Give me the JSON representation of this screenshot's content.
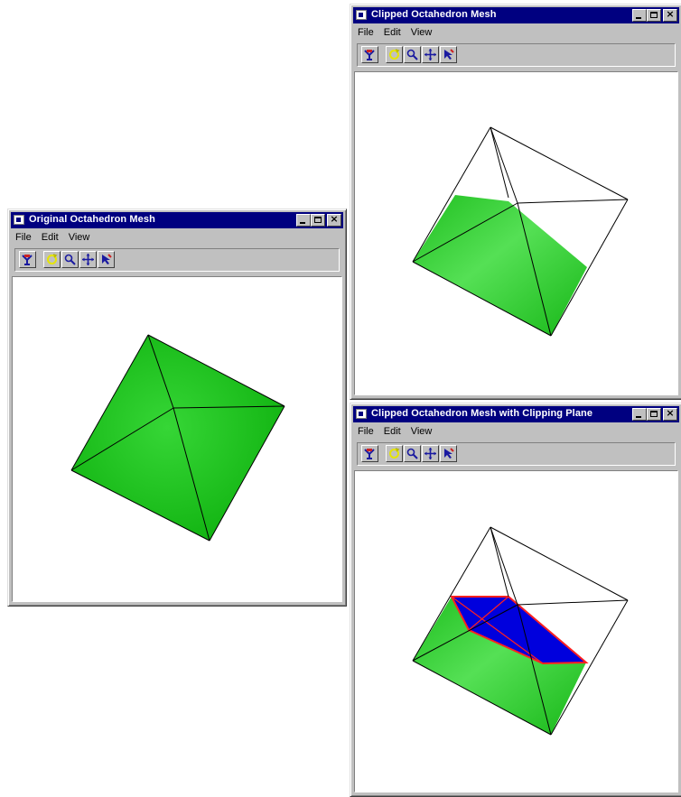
{
  "menu": [
    "File",
    "Edit",
    "View"
  ],
  "title_buttons": {
    "minimize": "minimize-icon",
    "maximize": "maximize-icon",
    "close": "close-icon"
  },
  "toolbar_icons": [
    "reset-view-icon",
    "rotate-icon",
    "zoom-icon",
    "pan-icon",
    "select-icon"
  ],
  "colors": {
    "titlebar": "#000080",
    "mesh_green": "#22cc22",
    "clip_face_blue": "#0000dd",
    "clip_edge_red": "#ff2020",
    "edge": "#000000"
  },
  "windows": {
    "original": {
      "title": "Original Octahedron Mesh"
    },
    "clipped": {
      "title": "Clipped Octahedron Mesh"
    },
    "clipped_plane": {
      "title": "Clipped Octahedron Mesh with Clipping Plane"
    }
  }
}
